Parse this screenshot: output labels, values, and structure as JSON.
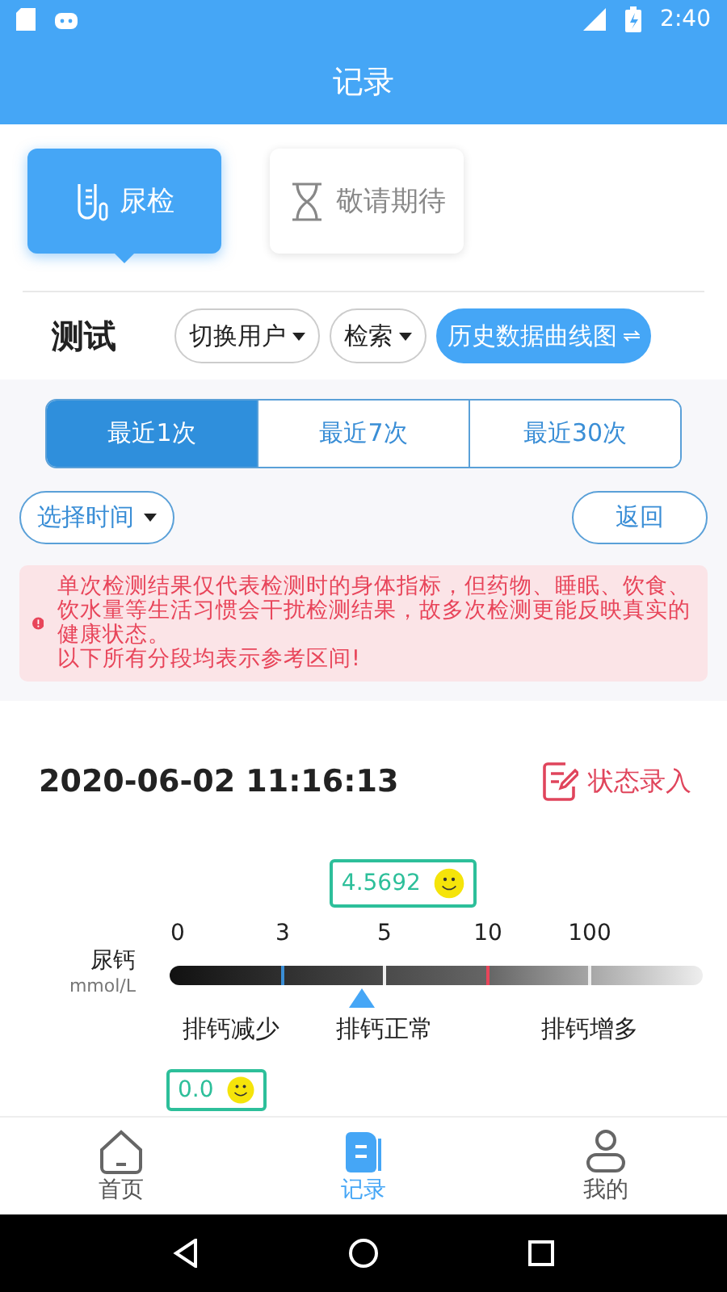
{
  "status_bar": {
    "time": "2:40"
  },
  "app_bar": {
    "title": "记录"
  },
  "categories": [
    {
      "label": "尿检",
      "selected": true
    },
    {
      "label": "敬请期待",
      "selected": false
    }
  ],
  "toolbar": {
    "user": "测试",
    "buttons": [
      {
        "label": "切换用户",
        "kind": "dropdown"
      },
      {
        "label": "检索",
        "kind": "dropdown"
      },
      {
        "label": "历史数据曲线图",
        "kind": "primary"
      }
    ]
  },
  "range_tabs": [
    {
      "label": "最近1次",
      "selected": true
    },
    {
      "label": "最近7次",
      "selected": false
    },
    {
      "label": "最近30次",
      "selected": false
    }
  ],
  "select_time": "选择时间",
  "back_button": "返回",
  "notice": {
    "lines": [
      "单次检测结果仅代表检测时的身体指标，但药物、睡眠、饮食、饮水量等生活习惯会干扰检测结果，故多次检测更能反映真实的健康状态。",
      "以下所有分段均表示参考区间!"
    ]
  },
  "record": {
    "datetime": "2020-06-02 11:16:13",
    "action": "状态录入"
  },
  "measurements": [
    {
      "name": "尿钙",
      "unit": "mmol/L",
      "value": "4.5692",
      "ticks": [
        "0",
        "3",
        "5",
        "10",
        "100"
      ],
      "zones": [
        "排钙减少",
        "排钙正常",
        "排钙增多"
      ]
    }
  ],
  "next_value": "0.0",
  "bottom_nav": [
    {
      "label": "首页",
      "selected": false
    },
    {
      "label": "记录",
      "selected": true
    },
    {
      "label": "我的",
      "selected": false
    }
  ]
}
